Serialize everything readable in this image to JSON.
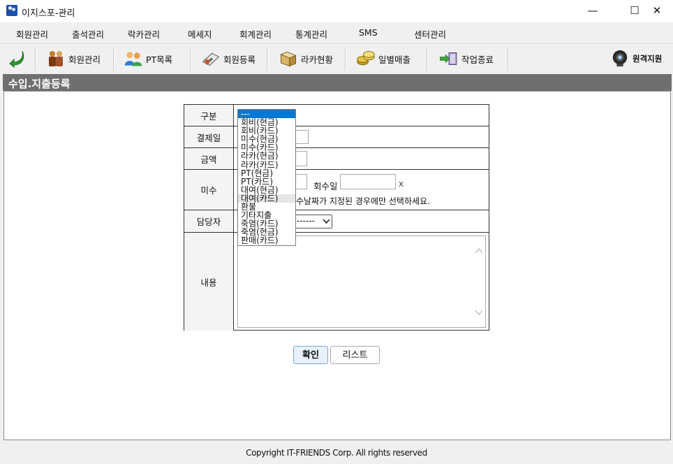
{
  "window": {
    "title": "이지스포-관리",
    "minimize": "—",
    "maximize": "☐",
    "close": "✕"
  },
  "menu": [
    "회원관리",
    "출석관리",
    "락카관리",
    "메세지",
    "회계관리",
    "통계관리",
    "SMS",
    "센터관리"
  ],
  "toolbar": {
    "member": "회원관리",
    "pt_list": "PT목록",
    "register": "회원등록",
    "locker": "라카현황",
    "daily_sales": "일별매출",
    "exit": "작업종료",
    "remote": "원격지원"
  },
  "page_header": "수입.지출등록",
  "form": {
    "category_label": "구분",
    "payment_date_label": "결제일",
    "amount_label": "금액",
    "unpaid_label": "미수",
    "collect_date_label": "회수일",
    "collect_x": "x",
    "unpaid_hint": "수날짜가 지정된 경우에만 선택하세요.",
    "staff_label": "담당자",
    "staff_select_value": "------",
    "content_label": "내용"
  },
  "dropdown": {
    "selected": "---",
    "hovered": "대여(카드)",
    "options": [
      "---",
      "회비(현금)",
      "회비(카드)",
      "미수(현금)",
      "미수(카드)",
      "라카(현금)",
      "라카(카드)",
      "PT(현금)",
      "PT(카드)",
      "대여(현금)",
      "대여(카드)",
      "환불",
      "기타지출",
      "죽염(카드)",
      "죽염(현금)",
      "판매(카드)"
    ]
  },
  "buttons": {
    "confirm": "확인",
    "list": "리스트"
  },
  "footer": "Copyright IT-FRIENDS Corp.  All rights reserved",
  "colors": {
    "header_strip": "#6f6f6f",
    "selected": "#0078d7"
  }
}
